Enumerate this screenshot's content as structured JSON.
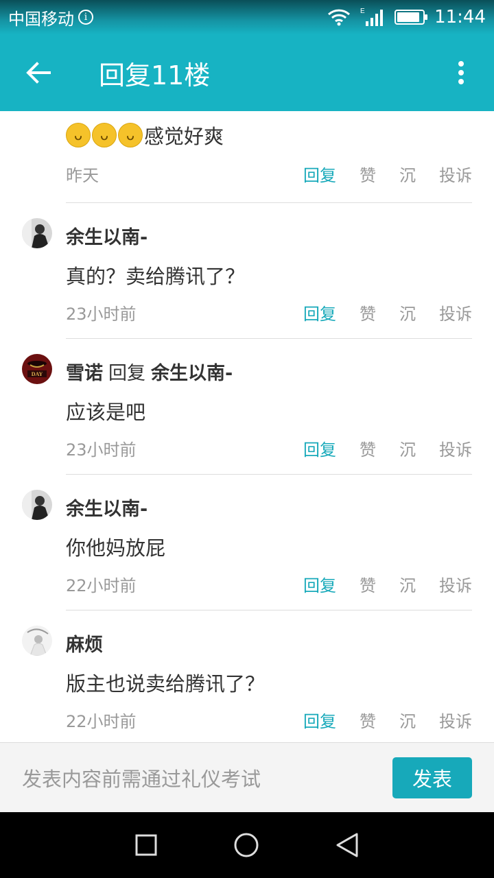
{
  "status_bar": {
    "carrier": "中国移动",
    "time": "11:44",
    "network_type": "E",
    "battery_level": 0.9
  },
  "app_bar": {
    "title": "回复11楼"
  },
  "first_item": {
    "text": "感觉好爽",
    "emoji_count": 3,
    "time": "昨天"
  },
  "actions": {
    "reply": "回复",
    "like": "赞",
    "sink": "沉",
    "report": "投诉"
  },
  "comments": [
    {
      "author": "余生以南-",
      "reply_to": "",
      "text": "真的？卖给腾讯了？",
      "time": "23小时前"
    },
    {
      "author": "雪诺",
      "reply_verb": "回复",
      "reply_to": "余生以南-",
      "text": "应该是吧",
      "time": "23小时前",
      "avatar_text": "DAY"
    },
    {
      "author": "余生以南-",
      "reply_to": "",
      "text": "你他妈放屁",
      "time": "22小时前"
    },
    {
      "author": "麻烦",
      "reply_to": "",
      "text": "版主也说卖给腾讯了？",
      "time": "22小时前"
    }
  ],
  "input_bar": {
    "placeholder": "发表内容前需通过礼仪考试",
    "send_label": "发表"
  },
  "colors": {
    "accent": "#17b3c3",
    "link": "#17a9ba"
  }
}
